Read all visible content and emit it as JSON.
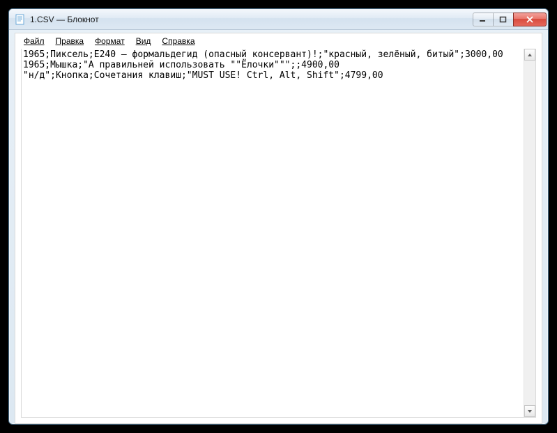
{
  "window": {
    "title": "1.CSV — Блокнот"
  },
  "menu": {
    "file": "Файл",
    "edit": "Правка",
    "format": "Формат",
    "view": "Вид",
    "help": "Справка"
  },
  "content": {
    "text": "1965;Пиксель;E240 – формальдегид (опасный консервант)!;\"красный, зелёный, битый\";3000,00\n1965;Мышка;\"А правильней использовать \"\"Ёлочки\"\"\";;4900,00\n\"н/д\";Кнопка;Сочетания клавиш;\"MUST USE! Ctrl, Alt, Shift\";4799,00"
  }
}
